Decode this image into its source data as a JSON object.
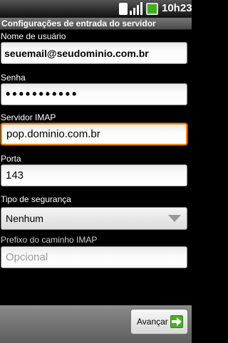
{
  "status_bar": {
    "time": "10h23",
    "icons": [
      "wifi-icon",
      "signal-icon",
      "battery-icon"
    ]
  },
  "title": "Configurações de entrada do servidor",
  "fields": {
    "username": {
      "label": "Nome de usuário",
      "value": "seuemail@seudominio.com.br"
    },
    "password": {
      "label": "Senha",
      "value": "•••••••••••"
    },
    "imap_server": {
      "label": "Servidor IMAP",
      "value": "pop.dominio.com.br"
    },
    "port": {
      "label": "Porta",
      "value": "143"
    },
    "security": {
      "label": "Tipo de segurança",
      "value": "Nenhum"
    },
    "imap_prefix": {
      "label": "Prefixo do caminho IMAP",
      "placeholder": "Opcional"
    }
  },
  "next_button": {
    "label": "Avançar"
  },
  "colors": {
    "focus_border": "#f08a10",
    "next_arrow": "#4caf2a",
    "battery": "#3fb116"
  }
}
